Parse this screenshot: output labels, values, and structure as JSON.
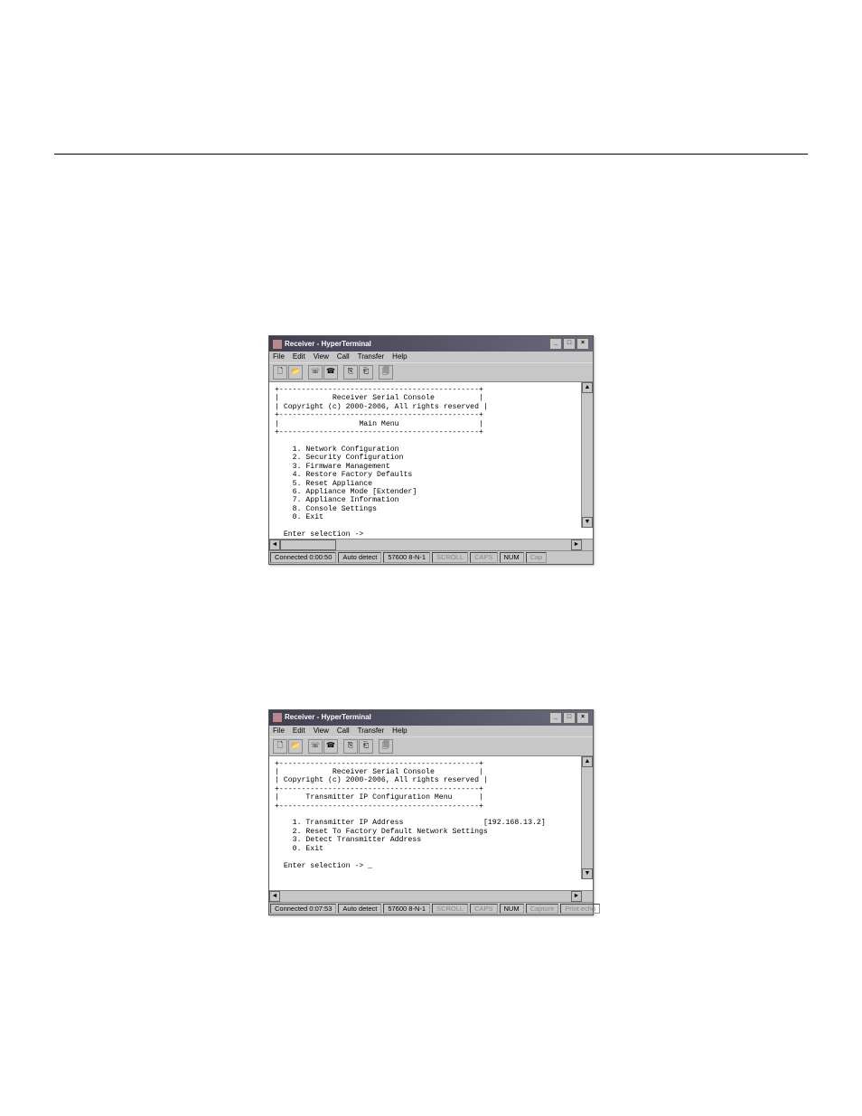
{
  "window1": {
    "title": "Receiver - HyperTerminal",
    "menu": [
      "File",
      "Edit",
      "View",
      "Call",
      "Transfer",
      "Help"
    ],
    "terminal": {
      "header_line1": "Receiver Serial Console",
      "header_line2": "Copyright (c) 2000-2006, All rights reserved",
      "section_title": "Main Menu",
      "items": [
        "1. Network Configuration",
        "2. Security Configuration",
        "3. Firmware Management",
        "4. Restore Factory Defaults",
        "5. Reset Appliance",
        "6. Appliance Mode [Extender]",
        "7. Appliance Information",
        "8. Console Settings",
        "0. Exit"
      ],
      "prompt": "Enter selection ->"
    },
    "status": {
      "connected": "Connected 0:00:50",
      "detect": "Auto detect",
      "baud": "57600 8-N-1",
      "scroll": "SCROLL",
      "caps": "CAPS",
      "num": "NUM",
      "capture": "Cap"
    }
  },
  "window2": {
    "title": "Receiver - HyperTerminal",
    "menu": [
      "File",
      "Edit",
      "View",
      "Call",
      "Transfer",
      "Help"
    ],
    "terminal": {
      "header_line1": "Receiver Serial Console",
      "header_line2": "Copyright (c) 2000-2006, All rights reserved",
      "section_title": "Transmitter IP Configuration Menu",
      "items": [
        {
          "label": "1. Transmitter IP Address",
          "value": "[192.168.13.2]"
        },
        {
          "label": "2. Reset To Factory Default Network Settings",
          "value": ""
        },
        {
          "label": "3. Detect Transmitter Address",
          "value": ""
        },
        {
          "label": "0. Exit",
          "value": ""
        }
      ],
      "prompt": "Enter selection -> _"
    },
    "status": {
      "connected": "Connected 0:07:53",
      "detect": "Auto detect",
      "baud": "57600 8-N-1",
      "scroll": "SCROLL",
      "caps": "CAPS",
      "num": "NUM",
      "capture": "Capture",
      "print": "Print echo"
    }
  }
}
